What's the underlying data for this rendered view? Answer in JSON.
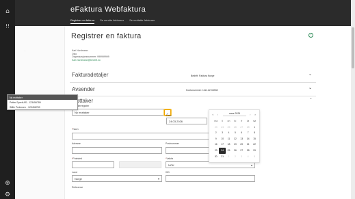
{
  "app": {
    "title": "eFaktura Webfaktura",
    "tabs": [
      "Registrer en faktura",
      "Se sendte fakturaer",
      "Se mottatte fakturaer"
    ]
  },
  "rail": {
    "icons": [
      "home-icon",
      "apps-grid-icon",
      "language-icon",
      "settings-icon"
    ]
  },
  "page": {
    "title": "Registrer en faktura",
    "help_glyph": "?"
  },
  "user": {
    "name": "Kari Nordmann",
    "org": "Oslo",
    "orgnr": "Organisasjonsnummer: 999999999",
    "email": "Kari.Nordmann@bedrift.no"
  },
  "sections": [
    {
      "title": "Fakturadetaljer",
      "info": "Bedrift: Faktura Norge",
      "expanded": false
    },
    {
      "title": "Avsender",
      "info": "Kontonummer: 1111.22.33333",
      "expanded": false
    },
    {
      "title": "Mottaker",
      "info": "",
      "expanded": true
    }
  ],
  "chevrons": {
    "down": "⌄",
    "up": "ˆ"
  },
  "form": {
    "register_label": "Mottakerregister",
    "register_value": "Ny mottaker",
    "register_options": [
      "Ny mottaker",
      "Petter Sprett AS - 123456789",
      "Ståle Pedersen - 123456789"
    ],
    "date_label": "Dato",
    "date_value": "24.03.2026",
    "name_label": "Navn",
    "address_label": "Adresse",
    "postal_code_label": "Postnummer",
    "postal_place_label": "Poststed",
    "country_label": "Land",
    "country_value": "Norge",
    "currency_label": "Valuta",
    "currency_value": "NOK",
    "kid_label": "KID",
    "reference_label": "Referanse",
    "required_mark": "*"
  },
  "calendar": {
    "month_label": "mars 2026",
    "nav_first": "«",
    "nav_prev": "‹",
    "nav_next": "›",
    "nav_last": "»",
    "weekdays": [
      "ma",
      "ti",
      "on",
      "to",
      "fr",
      "lø",
      "sø"
    ],
    "weeks": [
      [
        "23",
        "24",
        "25",
        "26",
        "27",
        "28",
        "1"
      ],
      [
        "2",
        "3",
        "4",
        "5",
        "6",
        "7",
        "8"
      ],
      [
        "9",
        "10",
        "11",
        "12",
        "13",
        "14",
        "15"
      ],
      [
        "16",
        "17",
        "18",
        "19",
        "20",
        "21",
        "22"
      ],
      [
        "23",
        "24",
        "25",
        "26",
        "27",
        "28",
        "29"
      ],
      [
        "30",
        "31",
        "1",
        "2",
        "3",
        "4",
        "5"
      ]
    ],
    "today": "24"
  }
}
